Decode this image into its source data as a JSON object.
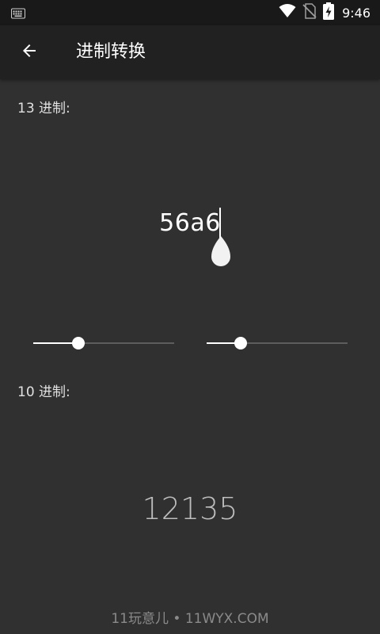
{
  "status_bar": {
    "time": "9:46",
    "icons": [
      "keyboard-icon",
      "wifi-icon",
      "no-sim-icon",
      "battery-charging-icon"
    ]
  },
  "app_bar": {
    "title": "进制转换",
    "back_icon": "arrow-back-icon"
  },
  "source": {
    "label": "13 进制:",
    "value": "56a6",
    "base_slider_value": 0.32
  },
  "target": {
    "label": "10 进制:",
    "value": "12135",
    "base_slider_value": 0.24
  },
  "watermark": "11玩意儿 • 11WYX.COM",
  "colors": {
    "background": "#303030",
    "app_bar": "#212121",
    "status_bar": "#191919",
    "accent": "#ffffff",
    "result_text": "#bdbdbd"
  }
}
